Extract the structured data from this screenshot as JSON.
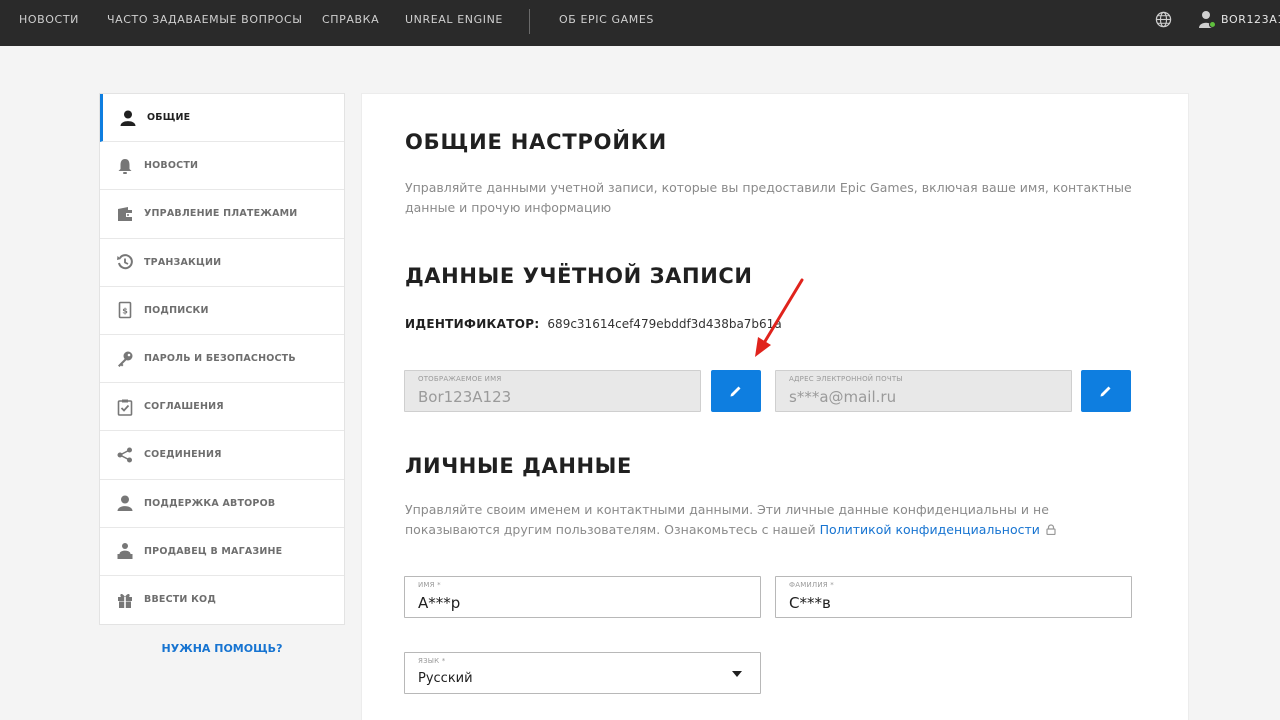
{
  "nav": {
    "items": [
      "НОВОСТИ",
      "ЧАСТО ЗАДАВАЕМЫЕ ВОПРОСЫ",
      "СПРАВКА",
      "UNREAL ENGINE",
      "ОБ EPIC GAMES"
    ],
    "username": "BOR123A1"
  },
  "sidebar": {
    "items": [
      {
        "label": "ОБЩИЕ",
        "icon": "user-icon",
        "active": true
      },
      {
        "label": "НОВОСТИ",
        "icon": "bell-icon"
      },
      {
        "label": "УПРАВЛЕНИЕ ПЛАТЕЖАМИ",
        "icon": "wallet-icon"
      },
      {
        "label": "ТРАНЗАКЦИИ",
        "icon": "history-icon"
      },
      {
        "label": "ПОДПИСКИ",
        "icon": "subscription-icon"
      },
      {
        "label": "ПАРОЛЬ И БЕЗОПАСНОСТЬ",
        "icon": "key-icon"
      },
      {
        "label": "СОГЛАШЕНИЯ",
        "icon": "clipboard-check-icon"
      },
      {
        "label": "СОЕДИНЕНИЯ",
        "icon": "share-icon"
      },
      {
        "label": "ПОДДЕРЖКА АВТОРОВ",
        "icon": "creator-icon"
      },
      {
        "label": "ПРОДАВЕЦ В МАГАЗИНЕ",
        "icon": "seller-icon"
      },
      {
        "label": "ВВЕСТИ КОД",
        "icon": "gift-icon"
      }
    ],
    "help": "НУЖНА ПОМОЩЬ?"
  },
  "main": {
    "title": "ОБЩИЕ НАСТРОЙКИ",
    "description": "Управляйте данными учетной записи, которые вы предоставили Epic Games, включая ваше имя, контактные данные и прочую информацию",
    "account": {
      "title": "ДАННЫЕ УЧЁТНОЙ ЗАПИСИ",
      "id_label": "ИДЕНТИФИКАТОР:",
      "id_value": "689c31614cef479ebddf3d438ba7b61a",
      "display_name_label": "ОТОБРАЖАЕМОЕ ИМЯ",
      "display_name_value": "Bor123A123",
      "email_label": "АДРЕС ЭЛЕКТРОННОЙ ПОЧТЫ",
      "email_value": "s***a@mail.ru"
    },
    "personal": {
      "title": "ЛИЧНЫЕ ДАННЫЕ",
      "description": "Управляйте своим именем и контактными данными. Эти личные данные конфиденциальны и не показываются другим пользователям. Ознакомьтесь с нашей ",
      "privacy_link": "Политикой конфиденциальности",
      "first_name_label": "ИМЯ *",
      "first_name_value": "А***р",
      "last_name_label": "ФАМИЛИЯ *",
      "last_name_value": "С***в",
      "language_label": "ЯЗЫК *",
      "language_value": "Русский"
    }
  },
  "colors": {
    "accent": "#0e7ee0",
    "topbar": "#2a2a2a",
    "annotation_arrow": "#e0231c",
    "online": "#5fbf3d"
  }
}
